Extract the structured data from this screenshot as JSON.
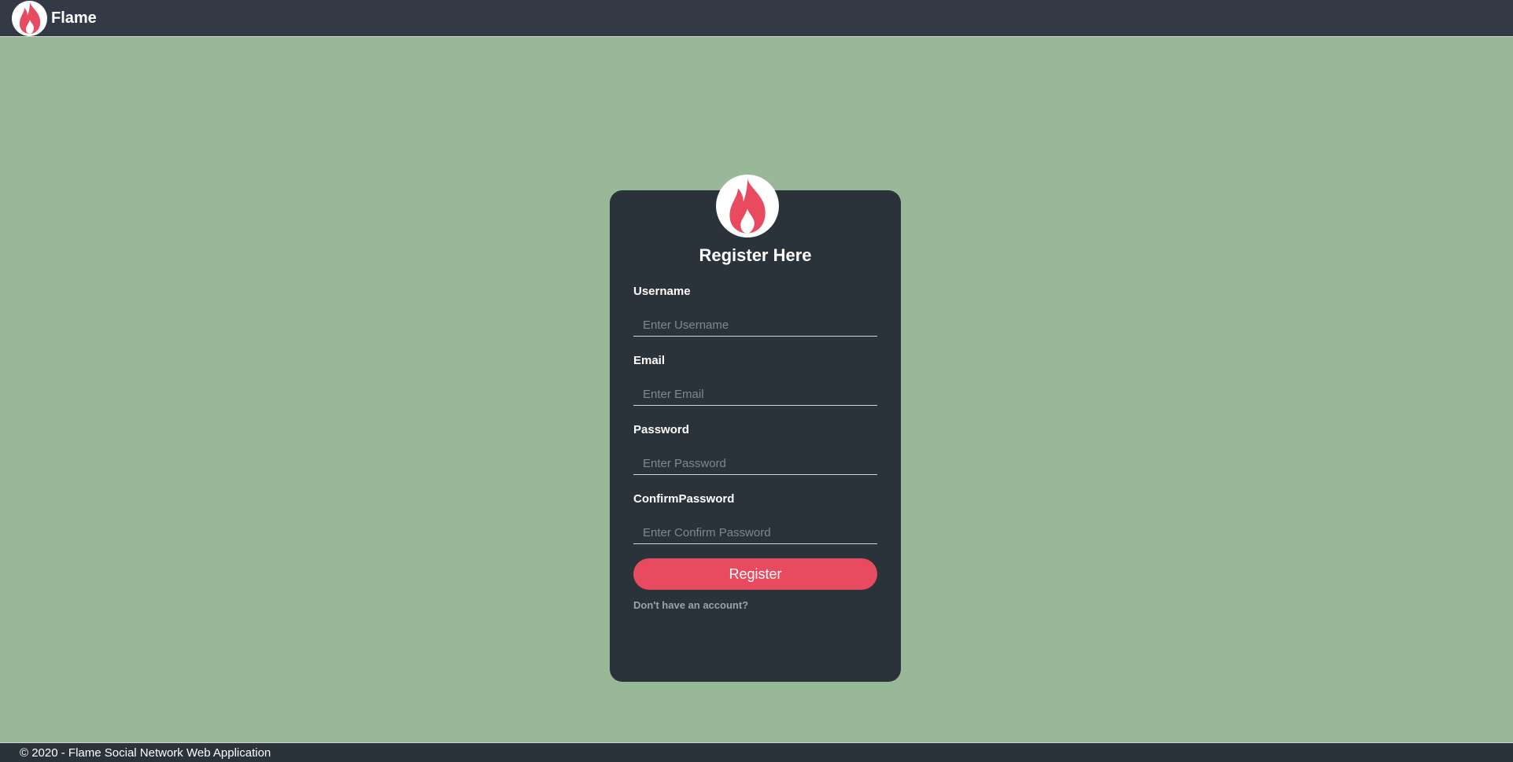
{
  "navbar": {
    "brand": "Flame",
    "logo_icon": "flame-icon"
  },
  "register_card": {
    "logo_icon": "flame-icon",
    "title": "Register Here",
    "fields": [
      {
        "label": "Username",
        "placeholder": "Enter Username",
        "value": ""
      },
      {
        "label": "Email",
        "placeholder": "Enter Email",
        "value": ""
      },
      {
        "label": "Password",
        "placeholder": "Enter Password",
        "value": ""
      },
      {
        "label": "ConfirmPassword",
        "placeholder": "Enter Confirm Password",
        "value": ""
      }
    ],
    "register_label": "Register",
    "account_link": "Don't have an account?"
  },
  "footer": {
    "text": "© 2020 - Flame Social Network Web Application"
  },
  "colors": {
    "background": "#99b898",
    "navbar": "#343a45",
    "card": "#2a323a",
    "accent": "#e84a5f"
  }
}
